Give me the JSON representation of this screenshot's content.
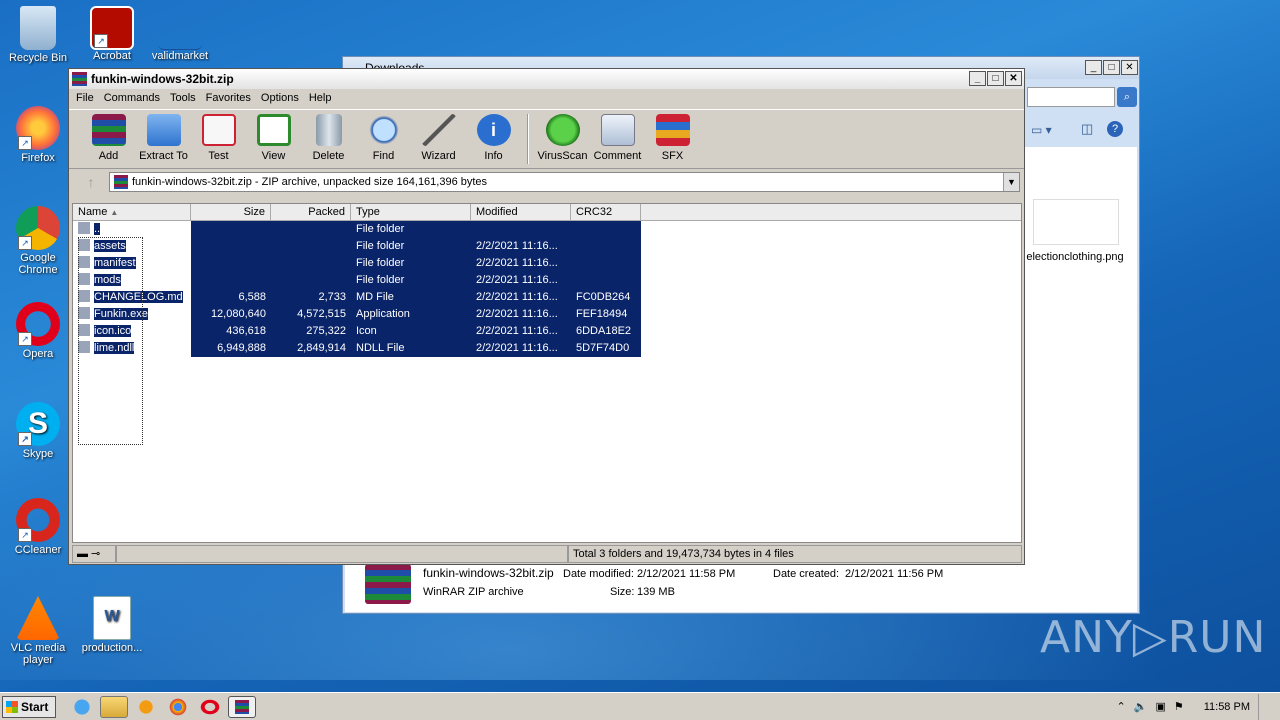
{
  "desktop": {
    "icons": [
      {
        "label": "Recycle Bin"
      },
      {
        "label": "Acrobat"
      },
      {
        "label": "validmarket"
      },
      {
        "label": "Firefox"
      },
      {
        "label": "Google Chrome"
      },
      {
        "label": "Opera"
      },
      {
        "label": "Skype"
      },
      {
        "label": "CCleaner"
      },
      {
        "label": "VLC media player"
      },
      {
        "label": "production..."
      }
    ]
  },
  "explorer": {
    "title": "Downloads",
    "thumb_label": "electionclothing.png",
    "details": {
      "name": "funkin-windows-32bit.zip",
      "modified_label": "Date modified:",
      "modified": "2/12/2021 11:58 PM",
      "created_label": "Date created:",
      "created": "2/12/2021 11:56 PM",
      "type": "WinRAR ZIP archive",
      "size_label": "Size:",
      "size": "139 MB"
    }
  },
  "winrar": {
    "title": "funkin-windows-32bit.zip",
    "menu": [
      "File",
      "Commands",
      "Tools",
      "Favorites",
      "Options",
      "Help"
    ],
    "toolbar": [
      "Add",
      "Extract To",
      "Test",
      "View",
      "Delete",
      "Find",
      "Wizard",
      "Info",
      "VirusScan",
      "Comment",
      "SFX"
    ],
    "address": "funkin-windows-32bit.zip - ZIP archive, unpacked size 164,161,396 bytes",
    "columns": [
      "Name",
      "Size",
      "Packed",
      "Type",
      "Modified",
      "CRC32"
    ],
    "rows": [
      {
        "name": "..",
        "size": "",
        "packed": "",
        "type": "File folder",
        "modified": "",
        "crc": ""
      },
      {
        "name": "assets",
        "size": "",
        "packed": "",
        "type": "File folder",
        "modified": "2/2/2021 11:16...",
        "crc": ""
      },
      {
        "name": "manifest",
        "size": "",
        "packed": "",
        "type": "File folder",
        "modified": "2/2/2021 11:16...",
        "crc": ""
      },
      {
        "name": "mods",
        "size": "",
        "packed": "",
        "type": "File folder",
        "modified": "2/2/2021 11:16...",
        "crc": ""
      },
      {
        "name": "CHANGELOG.md",
        "size": "6,588",
        "packed": "2,733",
        "type": "MD File",
        "modified": "2/2/2021 11:16...",
        "crc": "FC0DB264"
      },
      {
        "name": "Funkin.exe",
        "size": "12,080,640",
        "packed": "4,572,515",
        "type": "Application",
        "modified": "2/2/2021 11:16...",
        "crc": "FEF18494"
      },
      {
        "name": "icon.ico",
        "size": "436,618",
        "packed": "275,322",
        "type": "Icon",
        "modified": "2/2/2021 11:16...",
        "crc": "6DDA18E2"
      },
      {
        "name": "lime.ndll",
        "size": "6,949,888",
        "packed": "2,849,914",
        "type": "NDLL File",
        "modified": "2/2/2021 11:16...",
        "crc": "5D7F74D0"
      }
    ],
    "status": "Total 3 folders and 19,473,734 bytes in 4 files"
  },
  "taskbar": {
    "start": "Start",
    "clock": "11:58 PM"
  },
  "watermark": "ANY▷RUN"
}
